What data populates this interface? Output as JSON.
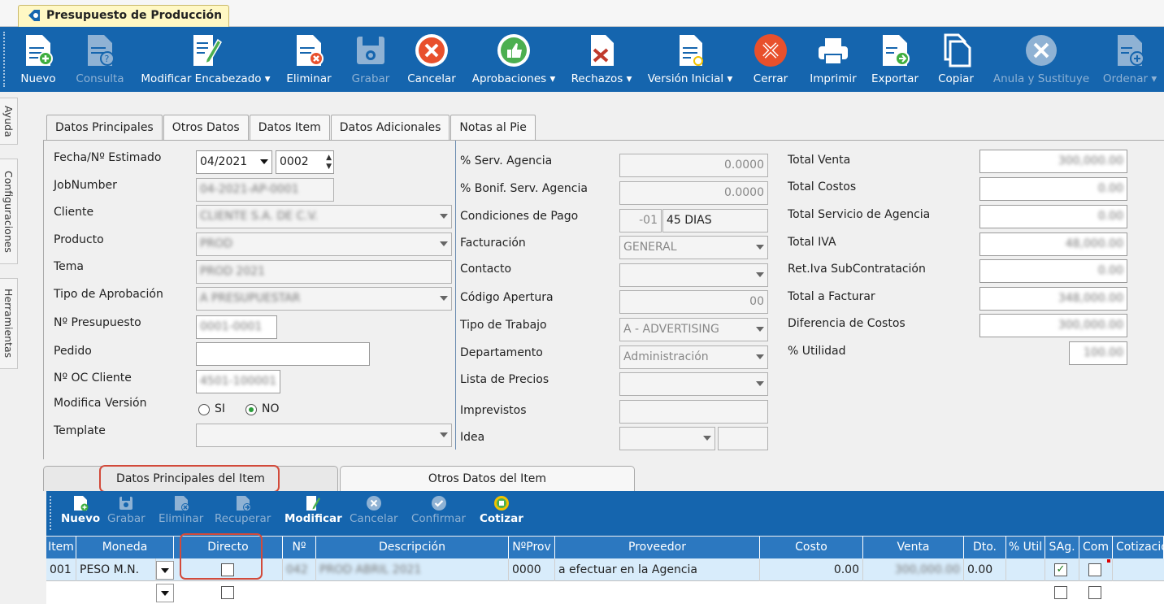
{
  "window": {
    "title": "Presupuesto de Producción"
  },
  "toolbar": [
    {
      "label": "Nuevo",
      "icon": "new-doc-icon",
      "enabled": true
    },
    {
      "label": "Consulta",
      "icon": "query-doc-icon",
      "enabled": false
    },
    {
      "label": "Modificar Encabezado ▾",
      "icon": "edit-doc-icon",
      "enabled": true
    },
    {
      "label": "Eliminar",
      "icon": "delete-doc-icon",
      "enabled": true
    },
    {
      "label": "Grabar",
      "icon": "save-icon",
      "enabled": false
    },
    {
      "label": "Cancelar",
      "icon": "cancel-icon",
      "enabled": true
    },
    {
      "label": "Aprobaciones ▾",
      "icon": "thumbs-up-icon",
      "enabled": true
    },
    {
      "label": "Rechazos ▾",
      "icon": "reject-doc-icon",
      "enabled": true
    },
    {
      "label": "Versión Inicial ▾",
      "icon": "version-doc-icon",
      "enabled": true
    },
    {
      "label": "Cerrar",
      "icon": "close-icon",
      "enabled": true
    },
    {
      "label": "Imprimir",
      "icon": "printer-icon",
      "enabled": true
    },
    {
      "label": "Exportar",
      "icon": "export-icon",
      "enabled": true
    },
    {
      "label": "Copiar",
      "icon": "copy-icon",
      "enabled": true
    },
    {
      "label": "Anula y Sustituye",
      "icon": "void-icon",
      "enabled": false
    },
    {
      "label": "Ordenar ▾",
      "icon": "order-doc-icon",
      "enabled": false
    }
  ],
  "sidetabs": [
    "Ayuda",
    "Configuraciones",
    "Herramientas"
  ],
  "tabs": [
    "Datos Principales",
    "Otros Datos",
    "Datos Item",
    "Datos Adicionales",
    "Notas al Pie"
  ],
  "left": {
    "fecha_label": "Fecha/Nº Estimado",
    "fecha_value": "04/2021",
    "estimado_value": "0002",
    "jobnumber_label": "JobNumber",
    "jobnumber_value": "04-2021-AP-0001",
    "cliente_label": "Cliente",
    "cliente_value": "CLIENTE S.A. DE C.V.",
    "producto_label": "Producto",
    "producto_value": "PROD",
    "tema_label": "Tema",
    "tema_value": "PROD 2021",
    "tipo_aprob_label": "Tipo de Aprobación",
    "tipo_aprob_value": "A PRESUPUESTAR",
    "npresupuesto_label": "Nº Presupuesto",
    "npresupuesto_value": "0001-0001",
    "pedido_label": "Pedido",
    "pedido_value": "",
    "noc_label": "Nº OC Cliente",
    "noc_value": "4501-100001",
    "modifica_label": "Modifica Versión",
    "si_label": "SI",
    "no_label": "NO",
    "template_label": "Template",
    "template_value": ""
  },
  "mid": {
    "serv_label": "% Serv. Agencia",
    "serv_value": "0.0000",
    "bonif_label": "% Bonif. Serv. Agencia",
    "bonif_value": "0.0000",
    "cond_label": "Condiciones de Pago",
    "cond_code": "-01",
    "cond_value": "45 DIAS",
    "fact_label": "Facturación",
    "fact_value": "GENERAL",
    "contacto_label": "Contacto",
    "codigo_label": "Código Apertura",
    "codigo_value": "00",
    "tipo_trab_label": "Tipo de Trabajo",
    "tipo_trab_value": "A - ADVERTISING",
    "depto_label": "Departamento",
    "depto_value": "Administración",
    "lista_label": "Lista de Precios",
    "imprev_label": "Imprevistos",
    "idea_label": "Idea"
  },
  "right": [
    {
      "label": "Total Venta",
      "value": "300,000.00"
    },
    {
      "label": "Total Costos",
      "value": "0.00"
    },
    {
      "label": "Total Servicio de Agencia",
      "value": "0.00"
    },
    {
      "label": "Total IVA",
      "value": "48,000.00"
    },
    {
      "label": "Ret.Iva SubContratación",
      "value": "0.00"
    },
    {
      "label": "Total a Facturar",
      "value": "348,000.00"
    },
    {
      "label": "Diferencia de Costos",
      "value": "300,000.00"
    },
    {
      "label": "% Utilidad",
      "value": "100.00"
    }
  ],
  "item_tabs": [
    "Datos Principales del Item",
    "Otros Datos del Item"
  ],
  "subtoolbar": [
    {
      "label": "Nuevo",
      "icon": "new-item-icon",
      "enabled": true
    },
    {
      "label": "Grabar",
      "icon": "save-item-icon",
      "enabled": false
    },
    {
      "label": "Eliminar",
      "icon": "delete-item-icon",
      "enabled": false
    },
    {
      "label": "Recuperar",
      "icon": "recover-item-icon",
      "enabled": false
    },
    {
      "label": "Modificar",
      "icon": "edit-item-icon",
      "enabled": true
    },
    {
      "label": "Cancelar",
      "icon": "cancel-item-icon",
      "enabled": false
    },
    {
      "label": "Confirmar",
      "icon": "confirm-item-icon",
      "enabled": false
    },
    {
      "label": "Cotizar",
      "icon": "quote-item-icon",
      "enabled": true
    }
  ],
  "grid": {
    "headers": [
      "Item",
      "Moneda",
      "Directo",
      "Nº",
      "Descripción",
      "NºProv",
      "Proveedor",
      "Costo",
      "Venta",
      "Dto.",
      "% Util",
      "SAg.",
      "Com",
      "Cotizacio"
    ],
    "row": {
      "item": "001",
      "moneda": "PESO M.N.",
      "directo": false,
      "n": "042",
      "descripcion": "PROD ABRIL 2021",
      "nprov": "0000",
      "proveedor": "a efectuar en la Agencia",
      "costo": "0.00",
      "venta": "300,000.00",
      "dto": "0.00",
      "sag": true,
      "com": false
    }
  }
}
